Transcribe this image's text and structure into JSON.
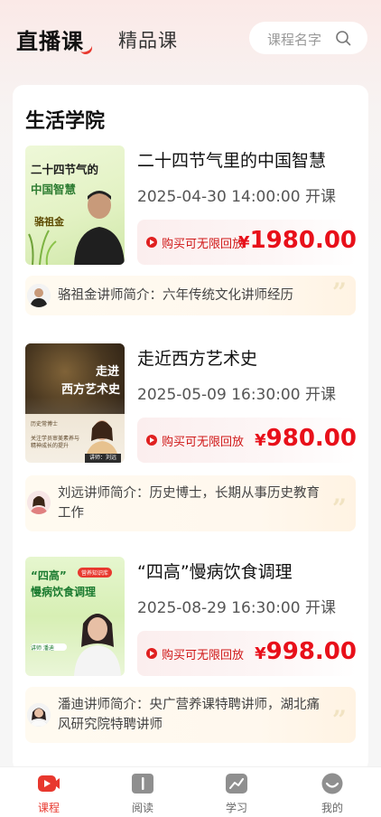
{
  "header": {
    "tabs": [
      {
        "label": "直播课",
        "active": true
      },
      {
        "label": "精品课",
        "active": false
      }
    ],
    "search_placeholder": "课程名字"
  },
  "section": {
    "title": "生活学院"
  },
  "courses": [
    {
      "title": "二十四节气里的中国智慧",
      "date": "2025-04-30 14:00:00 开课",
      "buy_label": "购买可无限回放",
      "price_symbol": "¥",
      "price": "1980.00",
      "teacher_intro": "骆祖金讲师简介：六年传统文化讲师经历",
      "thumb_title_1": "二十四节气的",
      "thumb_title_2": "中国智慧",
      "thumb_name": "骆祖金"
    },
    {
      "title": "走近西方艺术史",
      "date": "2025-05-09 16:30:00 开课",
      "buy_label": "购买可无限回放",
      "price_symbol": "¥",
      "price": "980.00",
      "teacher_intro_1": "刘远讲师简介：历史博士，长期从事历史教育",
      "teacher_intro_2": "工作",
      "thumb_title_1": "走进",
      "thumb_title_2": "西方艺术史",
      "thumb_bullet_1": "历史常博士",
      "thumb_bullet_2": "关注学员审美素养与",
      "thumb_bullet_3": "精神成长的提升",
      "thumb_name": "讲师：刘远"
    },
    {
      "title": "“四高”慢病饮食调理",
      "date": "2025-08-29 16:30:00 开课",
      "buy_label": "购买可无限回放",
      "price_symbol": "¥",
      "price": "998.00",
      "teacher_intro_1": "潘迪讲师简介：央广营养课特聘讲师，湖北痛",
      "teacher_intro_2": "风研究院特聘讲师",
      "thumb_title_1": "“四高”",
      "thumb_tag": "营养知识库",
      "thumb_title_2": "慢病饮食调理",
      "thumb_name": "讲师 潘迪"
    }
  ],
  "bottom_nav": [
    {
      "label": "课程",
      "icon": "play-icon",
      "active": true
    },
    {
      "label": "阅读",
      "icon": "book-icon",
      "active": false
    },
    {
      "label": "学习",
      "icon": "chart-icon",
      "active": false
    },
    {
      "label": "我的",
      "icon": "profile-icon",
      "active": false
    }
  ],
  "colors": {
    "accent": "#e8382e",
    "price": "#e8101a"
  }
}
